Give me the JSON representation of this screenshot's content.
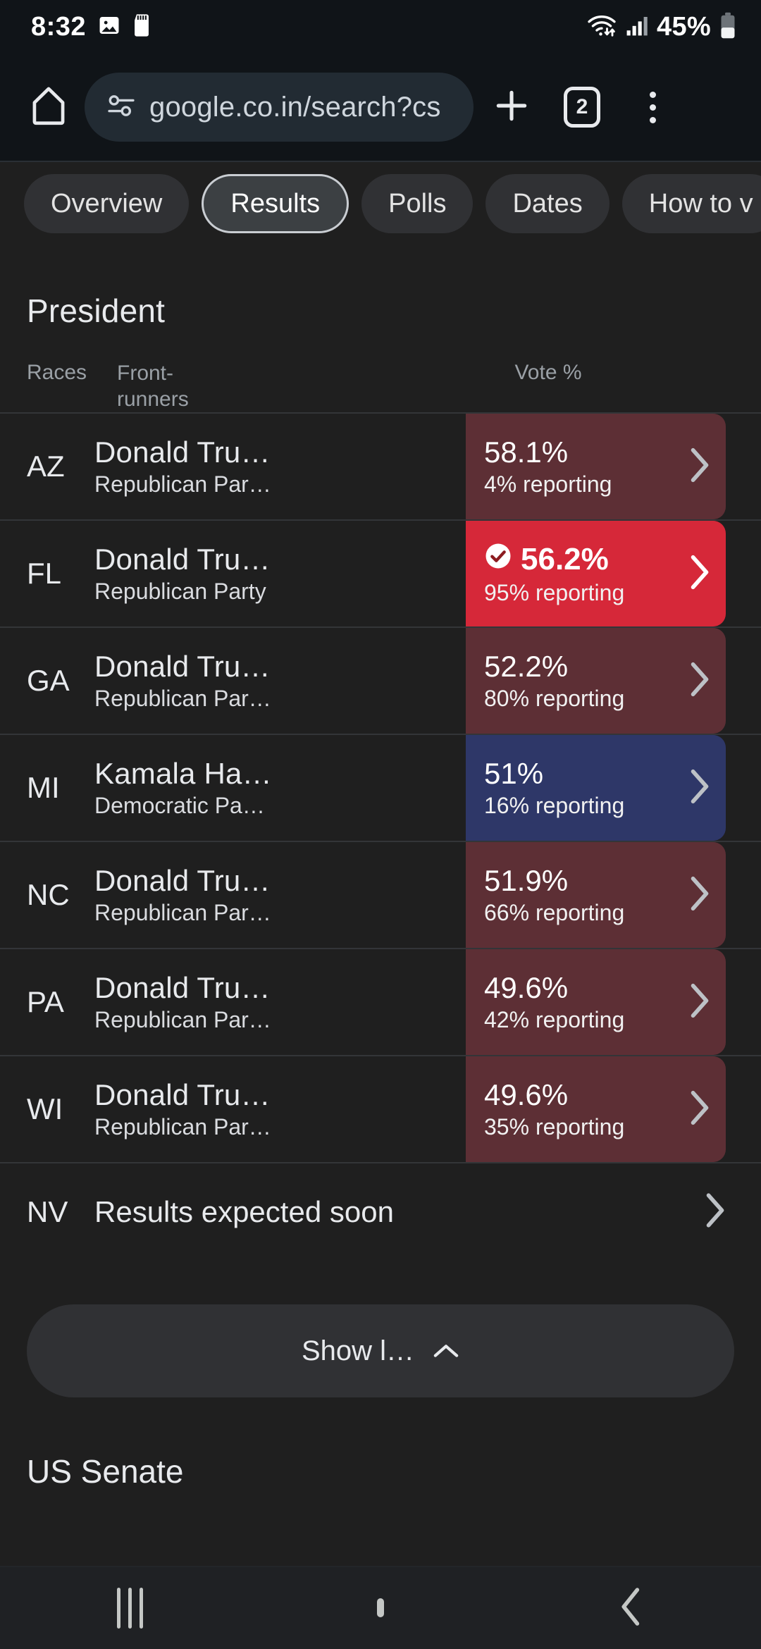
{
  "status_bar": {
    "time": "8:32",
    "battery": "45%",
    "icons": [
      "image-icon",
      "sd-card-icon",
      "wifi-icon",
      "signal-icon",
      "battery-icon"
    ]
  },
  "browser": {
    "url": "google.co.in/search?cs",
    "tab_count": "2",
    "icons": [
      "home-icon",
      "site-settings-icon",
      "new-tab-icon",
      "tab-switcher-icon",
      "overflow-menu-icon"
    ]
  },
  "chips": [
    {
      "label": "Overview",
      "selected": false
    },
    {
      "label": "Results",
      "selected": true
    },
    {
      "label": "Polls",
      "selected": false
    },
    {
      "label": "Dates",
      "selected": false
    },
    {
      "label": "How to v",
      "selected": false
    }
  ],
  "president": {
    "title": "President",
    "headers": {
      "races": "Races",
      "frontrunners_line1": "Front-",
      "frontrunners_line2": "runners",
      "vote": "Vote %"
    },
    "rows": [
      {
        "state": "AZ",
        "candidate": "Donald Tru…",
        "party": "Republican Par…",
        "pct": "58.1%",
        "reporting": "4% reporting",
        "bar": "red-muted",
        "winner": false
      },
      {
        "state": "FL",
        "candidate": "Donald Tru…",
        "party": "Republican Party",
        "pct": "56.2%",
        "reporting": "95% reporting",
        "bar": "red-strong",
        "winner": true
      },
      {
        "state": "GA",
        "candidate": "Donald Tru…",
        "party": "Republican Par…",
        "pct": "52.2%",
        "reporting": "80% reporting",
        "bar": "red-muted",
        "winner": false
      },
      {
        "state": "MI",
        "candidate": "Kamala Ha…",
        "party": "Democratic Pa…",
        "pct": "51%",
        "reporting": "16% reporting",
        "bar": "blue",
        "winner": false
      },
      {
        "state": "NC",
        "candidate": "Donald Tru…",
        "party": "Republican Par…",
        "pct": "51.9%",
        "reporting": "66% reporting",
        "bar": "red-muted",
        "winner": false
      },
      {
        "state": "PA",
        "candidate": "Donald Tru…",
        "party": "Republican Par…",
        "pct": "49.6%",
        "reporting": "42% reporting",
        "bar": "red-muted",
        "winner": false
      },
      {
        "state": "WI",
        "candidate": "Donald Tru…",
        "party": "Republican Par…",
        "pct": "49.6%",
        "reporting": "35% reporting",
        "bar": "red-muted",
        "winner": false
      }
    ],
    "pending_row": {
      "state": "NV",
      "message": "Results expected soon"
    },
    "show_more_label": "Show l…"
  },
  "next_section": {
    "title": "US Senate"
  },
  "nav_bar": {
    "icons": [
      "recents-icon",
      "home-icon",
      "back-icon"
    ]
  },
  "colors": {
    "republican_muted": "#5d2f35",
    "republican_strong": "#d62839",
    "democratic": "#2e3768",
    "background": "#1f1f1f",
    "chrome": "#101418"
  }
}
